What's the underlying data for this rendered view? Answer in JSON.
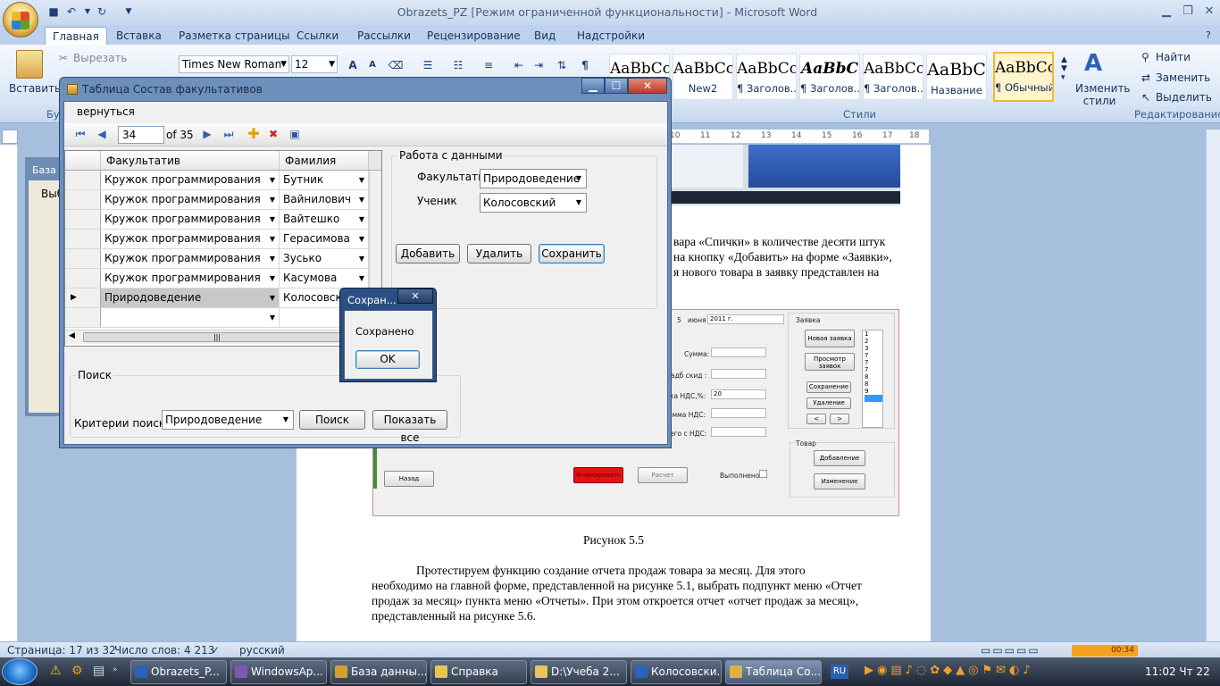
{
  "word": {
    "title": "Obrazets_PZ [Режим ограниченной функциональности] - Microsoft Word",
    "tabs": [
      "Главная",
      "Вставка",
      "Разметка страницы",
      "Ссылки",
      "Рассылки",
      "Рецензирование",
      "Вид",
      "Надстройки"
    ],
    "clipboard": {
      "paste": "Вставить",
      "cut": "Вырезать",
      "group_label": "Бу"
    },
    "font_name": "Times New Roman",
    "font_size": "12",
    "styles": [
      {
        "preview": "AaBbCc",
        "name": ""
      },
      {
        "preview": "AaBbCc",
        "name": "New2"
      },
      {
        "preview": "AaBbCc",
        "name": "¶ Заголов..."
      },
      {
        "preview": "AaBbC",
        "name": "¶ Заголов..."
      },
      {
        "preview": "AaBbCc",
        "name": "¶ Заголов..."
      },
      {
        "preview": "AaBbC",
        "name": "Название"
      },
      {
        "preview": "AaBbCcI",
        "name": "¶ Обычный"
      }
    ],
    "change_styles": "Изменить стили",
    "styles_group": "Стили",
    "editing": {
      "find": "Найти",
      "replace": "Заменить",
      "select": "Выделить",
      "group_label": "Редактирование"
    },
    "ruler_marks": [
      "10",
      "11",
      "12",
      "13",
      "14",
      "15",
      "16",
      "17",
      "18"
    ],
    "doc_paragraph1": [
      "вара «Спички» в количестве десяти штук",
      "на кнопку «Добавить» на форме «Заявки»,",
      "я нового товара в заявку представлен на"
    ],
    "figure_caption": "Рисунок 5.5",
    "doc_paragraph2": [
      "Протестируем функцию создание отчета продаж товара за месяц. Для этого",
      "необходимо на главной форме, представленной на рисунке 5.1, выбрать подпункт меню «Отчет",
      "продаж за месяц» пункта меню «Отчеты». При этом откроется отчет «отчет продаж за месяц»,",
      "представленный на рисунке 5.6."
    ],
    "status": {
      "page": "Страница: 17 из 32",
      "words": "Число слов: 4 213",
      "lang": "русский",
      "zoom": "00:34"
    }
  },
  "figure": {
    "date_day": "5",
    "date_month": "июня",
    "date_year": "2011 г.",
    "group_order": "Заявка",
    "new_order": "Новая заявка",
    "view_orders": "Просмотр заявок",
    "save": "Сохранение",
    "delete": "Удаление",
    "nav_prev": "<",
    "nav_next": ">",
    "list": [
      "1",
      "2",
      "3",
      "7",
      "7",
      "7",
      "8",
      "8",
      "9"
    ],
    "sum_label": "Сумма:",
    "discount_label": "надб  скид :",
    "vat_rate_label": "ка НДС,%:",
    "vat_rate_value": "20",
    "vat_sum_label": "умма НДС:",
    "total_label": "его с НДС:",
    "goods_group": "Товар",
    "add": "Добавление",
    "change": "Изменение",
    "back": "Назад",
    "form": "Формировать",
    "calc": "Расчет",
    "done_label": "Выполнено:"
  },
  "bg_window": {
    "title": "База д",
    "text": "Выб"
  },
  "dialog": {
    "title": "Таблица Состав факультативов",
    "menu_back": "вернуться",
    "position": "34",
    "of_total": "of 35",
    "columns": [
      "Факультатив",
      "Фамилия"
    ],
    "rows": [
      {
        "course": "Кружок программирования",
        "surname": "Бутник"
      },
      {
        "course": "Кружок программирования",
        "surname": "Вайнилович"
      },
      {
        "course": "Кружок программирования",
        "surname": "Вайтешко"
      },
      {
        "course": "Кружок программирования",
        "surname": "Герасимова"
      },
      {
        "course": "Кружок программирования",
        "surname": "Зуськo"
      },
      {
        "course": "Кружок программирования",
        "surname": "Касумова"
      },
      {
        "course": "Природоведение",
        "surname": "Колосовский"
      },
      {
        "course": "",
        "surname": ""
      }
    ],
    "work_group": "Работа с данными",
    "course_label": "Факультатив",
    "course_value": "Природоведение",
    "student_label": "Ученик",
    "student_value": "Колосовский",
    "add_btn": "Добавить",
    "delete_btn": "Удалить",
    "save_btn": "Сохранить",
    "search_group": "Поиск",
    "criteria_label": "Критерии поиска",
    "criteria_value": "Природоведение",
    "search_btn": "Поиск",
    "show_all_btn": "Показать все"
  },
  "msgbox": {
    "title": "Сохран...",
    "text": "Сохранено",
    "ok": "OK"
  },
  "taskbar": {
    "tasks": [
      "Obrazets_P...",
      "WindowsAp...",
      "База данны...",
      "Справка",
      "D:\\Учеба 2...",
      "Колосовски...",
      "Таблица Со..."
    ],
    "lang": "RU",
    "clock": "11:02 Чт 22"
  }
}
